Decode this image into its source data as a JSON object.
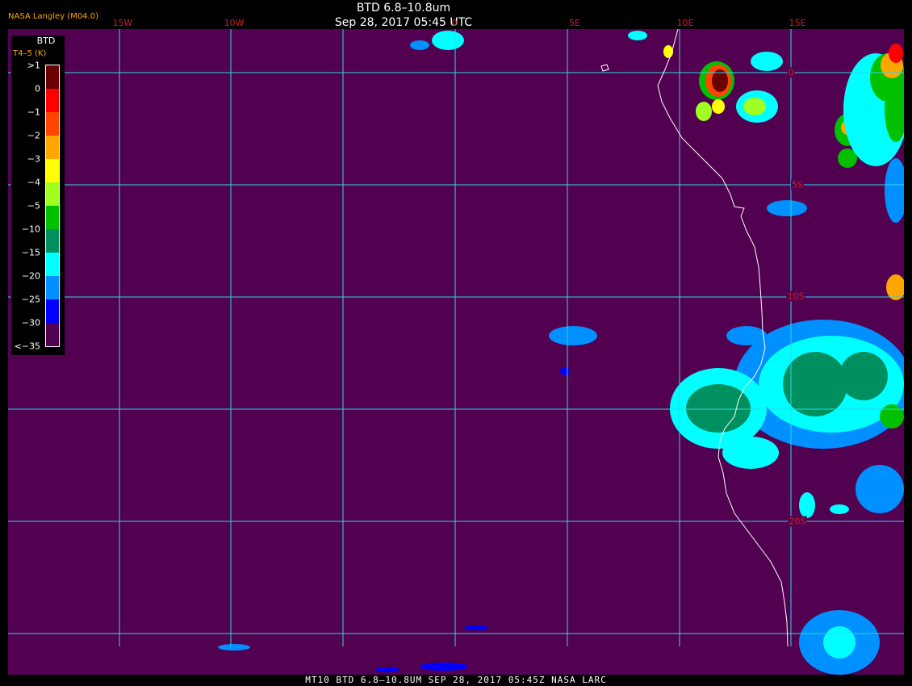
{
  "header": {
    "title": "BTD 6.8–10.8um",
    "subtitle": "Sep 28, 2017 05:45 UTC",
    "source": "NASA Langley (M04.0)"
  },
  "legend": {
    "title": "BTD",
    "units": "T4–5 (K)",
    "ticks": [
      ">1",
      "0",
      "−1",
      "−2",
      "−3",
      "−4",
      "−5",
      "−10",
      "−15",
      "−20",
      "−25",
      "−30",
      "<−35"
    ],
    "colors": [
      "#6b0000",
      "#ff0000",
      "#ff4500",
      "#ffa500",
      "#ffff00",
      "#a0ff20",
      "#00c000",
      "#009060",
      "#00ffff",
      "#0090ff",
      "#0000ff",
      "#520050"
    ]
  },
  "map": {
    "background": "#520050",
    "grid_color": "#2ad8e8",
    "coast_color": "#ffffff",
    "lon_labels": [
      "15W",
      "10W",
      "0",
      "5E",
      "10E",
      "15E"
    ],
    "lat_labels": [
      "0",
      "5S",
      "10S",
      "20S"
    ]
  },
  "footer": {
    "text": "MT10  BTD 6.8–10.8UM   SEP 28, 2017 05:45Z   NASA LARC"
  }
}
